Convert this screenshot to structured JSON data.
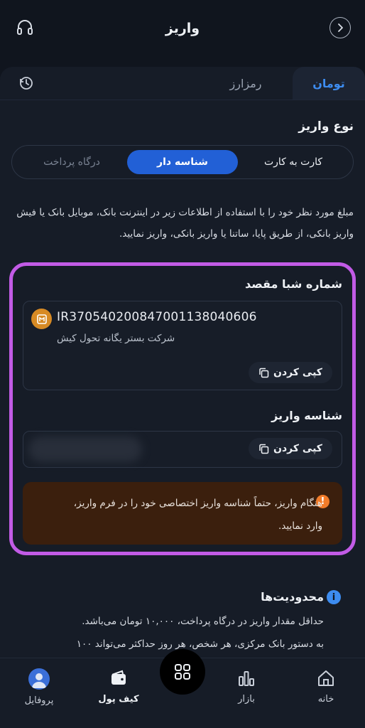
{
  "header": {
    "title": "واریز"
  },
  "tabs": {
    "active": "تومان",
    "inactive": "رمزارز"
  },
  "deposit_type": {
    "title": "نوع واریز",
    "options": [
      "کارت به کارت",
      "شناسه دار",
      "درگاه پرداخت"
    ],
    "selected": "شناسه دار"
  },
  "description": "مبلغ مورد نظر خود را با استفاده از اطلاعات زیر در اینترنت بانک، موبایل بانک یا فیش واریز بانکی، از طریق پایا، ساتنا یا واریز بانکی، واریز نمایید.",
  "sheba": {
    "label": "شماره شبا مقصد",
    "iban": "IR370540200847001138040606",
    "owner": "شرکت بستر یگانه تحول کیش",
    "copy_label": "کپی کردن"
  },
  "deposit_id": {
    "label": "شناسه واریز",
    "copy_label": "کپی کردن"
  },
  "warning": {
    "text": "هنگام واریز، حتماً شناسه واریز اختصاصی خود را در فرم واریز، وارد نمایید."
  },
  "limits": {
    "title": "محدودیت‌ها",
    "line1": "حداقل مقدار واریز در درگاه پرداخت، ۱۰,۰۰۰ تومان می‌باشد.",
    "line2": "به دستور بانک مرکزی، هر شخص، هر روز حداکثر می‌تواند ۱۰۰"
  },
  "nav": {
    "home": "خانه",
    "market": "بازار",
    "wallet": "کیف پول",
    "profile": "پروفایل"
  },
  "colors": {
    "accent": "#2260d6",
    "highlight": "#c25be6",
    "warning_bg": "#3b1f0d",
    "warning_icon": "#f27c2a"
  }
}
